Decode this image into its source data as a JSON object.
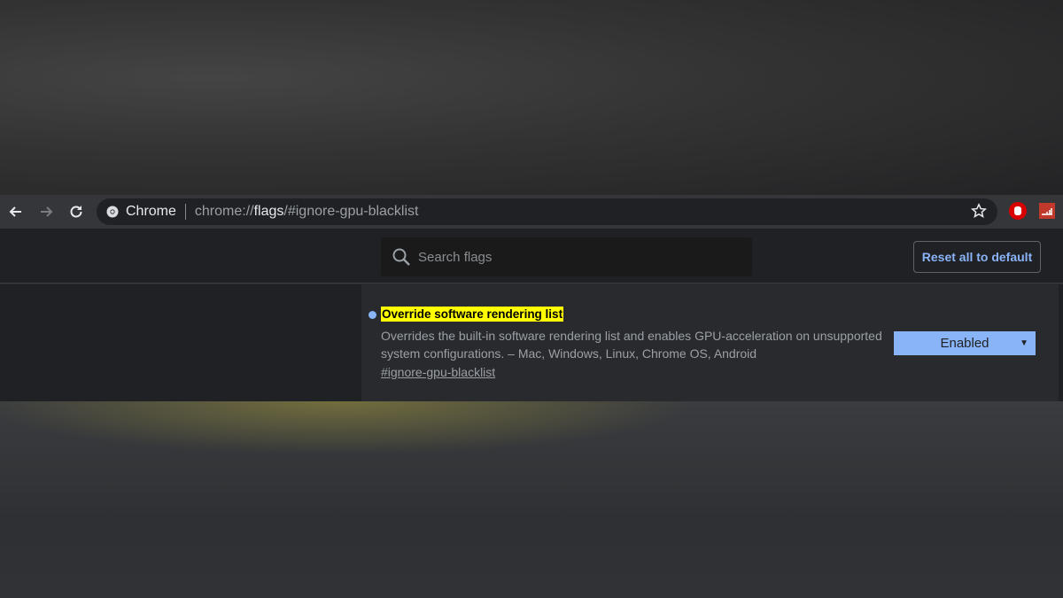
{
  "toolbar": {
    "site_label": "Chrome",
    "url_prefix": "chrome://",
    "url_host": "flags",
    "url_suffix": "/#ignore-gpu-blacklist"
  },
  "header": {
    "search_placeholder": "Search flags",
    "reset_label": "Reset all to default"
  },
  "flag": {
    "title": "Override software rendering list",
    "description": "Overrides the built-in software rendering list and enables GPU-acceleration on unsupported system configurations. – Mac, Windows, Linux, Chrome OS, Android",
    "link": "#ignore-gpu-blacklist",
    "selected": "Enabled",
    "dot_color": "#8ab4f8",
    "highlight_color": "#ffff00"
  },
  "icons": [
    "arrow-left-icon",
    "arrow-right-icon",
    "reload-icon",
    "chrome-icon",
    "star-icon",
    "stop-hand-extension-icon",
    "signal-extension-icon",
    "search-icon"
  ]
}
